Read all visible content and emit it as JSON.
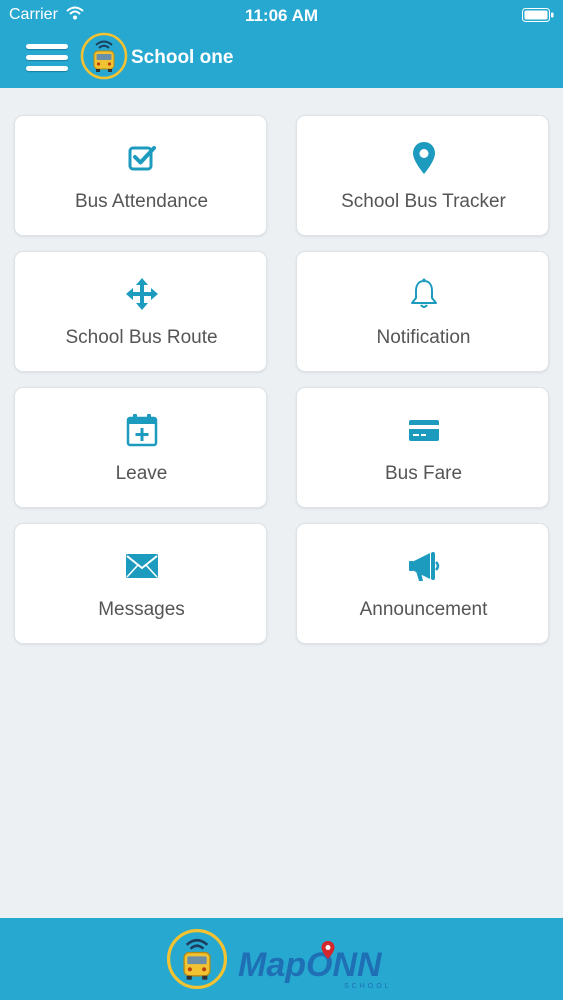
{
  "status": {
    "carrier": "Carrier",
    "time": "11:06 AM"
  },
  "header": {
    "title": "School one"
  },
  "colors": {
    "primary": "#27a8d1",
    "icon": "#1d9bbf",
    "background": "#ecf0f3"
  },
  "menu": [
    {
      "label": "Bus Attendance",
      "icon": "check-square-icon"
    },
    {
      "label": "School Bus Tracker",
      "icon": "map-pin-icon"
    },
    {
      "label": "School Bus Route",
      "icon": "arrows-move-icon"
    },
    {
      "label": "Notification",
      "icon": "bell-icon"
    },
    {
      "label": "Leave",
      "icon": "calendar-plus-icon"
    },
    {
      "label": "Bus Fare",
      "icon": "credit-card-icon"
    },
    {
      "label": "Messages",
      "icon": "envelope-icon"
    },
    {
      "label": "Announcement",
      "icon": "megaphone-icon"
    }
  ],
  "footer": {
    "brand_main": "MapONN",
    "brand_sub": "SCHOOL"
  }
}
